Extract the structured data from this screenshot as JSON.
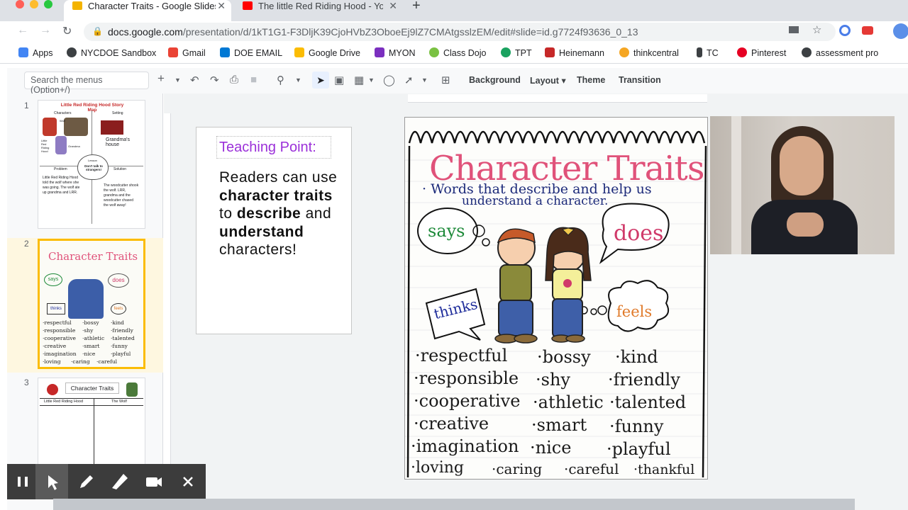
{
  "browser": {
    "tabs": [
      {
        "title": "Character Traits - Google Slides",
        "favicon": "slides-icon",
        "active": true
      },
      {
        "title": "The little Red Riding Hood - YouTube",
        "favicon": "youtube-icon",
        "active": false
      }
    ],
    "new_tab": "+",
    "close": "✕",
    "url_host": "docs.google.com",
    "url_path": "/presentation/d/1kT1G1-F3DljK39CjoHVbZ3OboeEj9lZ7CMAtgsslzEM/edit#slide=id.g7724f93636_0_13"
  },
  "bookmarks": [
    {
      "label": "Apps",
      "color": "#4285f4"
    },
    {
      "label": "NYCDOE Sandbox",
      "color": "#3c4043"
    },
    {
      "label": "Gmail",
      "color": "#ea4335"
    },
    {
      "label": "DOE EMAIL",
      "color": "#0078d4"
    },
    {
      "label": "Google Drive",
      "color": "#fbbc04"
    },
    {
      "label": "MYON",
      "color": "#7b2fbf"
    },
    {
      "label": "Class Dojo",
      "color": "#7ac142"
    },
    {
      "label": "TPT",
      "color": "#1aa260"
    },
    {
      "label": "Heinemann",
      "color": "#c62828"
    },
    {
      "label": "thinkcentral",
      "color": "#f5a623"
    },
    {
      "label": "TC",
      "color": "#3c4043"
    },
    {
      "label": "Pinterest",
      "color": "#e60023"
    },
    {
      "label": "assessment pro",
      "color": "#3c4043"
    }
  ],
  "toolbar": {
    "search_placeholder": "Search the menus (Option+/)",
    "background": "Background",
    "layout": "Layout",
    "theme": "Theme",
    "transition": "Transition"
  },
  "filmstrip": {
    "slides": [
      {
        "number": "1",
        "title": "Little Red Riding Hood Story Map",
        "labels": [
          "Characters",
          "Setting",
          "Wolf",
          "Grandma's house",
          "Little Red Riding Hood",
          "Grandma",
          "Problem",
          "Lesson",
          "Solution",
          "Don't talk to strangers!"
        ],
        "problem": "Little Red Riding Hood told the wolf where she was going. The wolf ate up grandma and LRR.",
        "solution": "The woodcutter shook the wolf. LRR, grandma and the woodcutter chased the wolf away!"
      },
      {
        "number": "2",
        "title": "Character Traits"
      },
      {
        "number": "3",
        "title": "Character Traits",
        "col1": "Little Red Riding Hood",
        "col2": "The Wolf"
      }
    ]
  },
  "slide": {
    "teaching_point_title": "Teaching Point:",
    "body": [
      {
        "text": "Readers can ",
        "bold": false
      },
      {
        "text": "use ",
        "bold": false
      },
      {
        "text": "character traits",
        "bold": true
      },
      {
        "text": " to ",
        "bold": false
      },
      {
        "text": "describe",
        "bold": true
      },
      {
        "text": " and ",
        "bold": false
      },
      {
        "text": "understand",
        "bold": true
      },
      {
        "text": " characters!",
        "bold": false
      }
    ]
  },
  "anchor_chart": {
    "title": "Character Traits",
    "subtitle_1": "· Words that describe and help us",
    "subtitle_2": "understand a character.",
    "bubbles": {
      "says": "says",
      "does": "does",
      "thinks": "thinks",
      "feels": "feels"
    },
    "traits": [
      [
        "·respectful",
        "·bossy",
        "·kind"
      ],
      [
        "·responsible",
        "·shy",
        "·friendly"
      ],
      [
        "·cooperative",
        "·athletic",
        "·talented"
      ],
      [
        "·creative",
        "·smart",
        "·funny"
      ],
      [
        "·imagination",
        "·nice",
        "·playful"
      ],
      [
        "·loving",
        "·caring",
        "·careful",
        "·thankful"
      ]
    ],
    "colors": {
      "title": "#e0527a",
      "subtitle": "#1c2a7a",
      "says": "#1e8a3a",
      "does": "#d03a6a",
      "thinks": "#1c2a9a",
      "feels": "#e07a2a"
    }
  },
  "recording_bar": {
    "buttons": [
      "pause-icon",
      "pointer-icon",
      "pen-icon",
      "highlighter-icon",
      "camera-icon",
      "close-icon"
    ]
  }
}
